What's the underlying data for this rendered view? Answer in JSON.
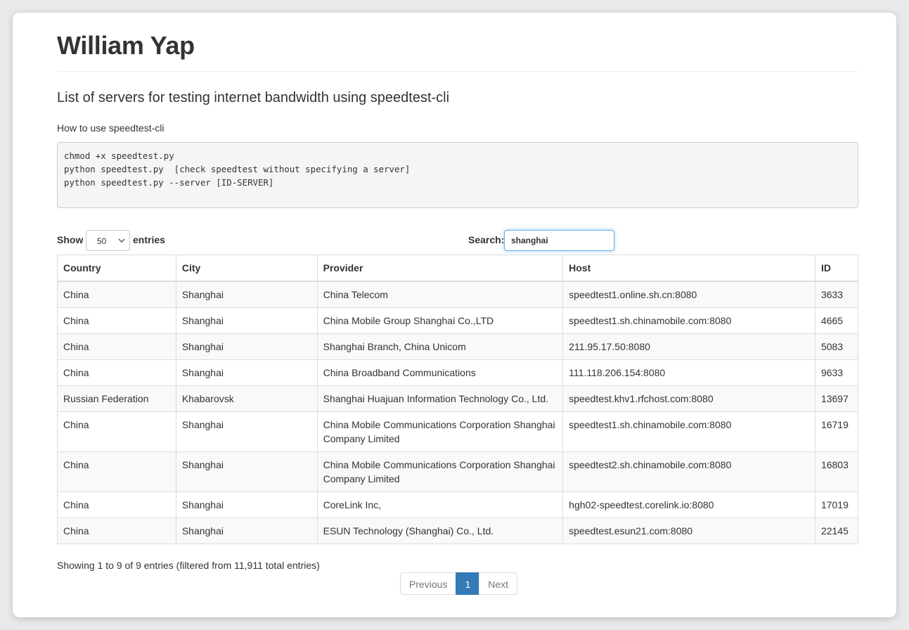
{
  "page": {
    "title": "William Yap",
    "lead": "List of servers for testing internet bandwidth using speedtest-cli",
    "howto_label": "How to use speedtest-cli",
    "code_lines": [
      "chmod +x speedtest.py",
      "python speedtest.py  [check speedtest without specifying a server]",
      "python speedtest.py --server [ID-SERVER]"
    ]
  },
  "controls": {
    "show_label": "Show",
    "length_value": "50",
    "entries_label": "entries",
    "search_label": "Search:",
    "search_value": "shanghai"
  },
  "table": {
    "headers": [
      "Country",
      "City",
      "Provider",
      "Host",
      "ID"
    ],
    "rows": [
      [
        "China",
        "Shanghai",
        "China Telecom",
        "speedtest1.online.sh.cn:8080",
        "3633"
      ],
      [
        "China",
        "Shanghai",
        "China Mobile Group Shanghai Co.,LTD",
        "speedtest1.sh.chinamobile.com:8080",
        "4665"
      ],
      [
        "China",
        "Shanghai",
        "Shanghai Branch, China Unicom",
        "211.95.17.50:8080",
        "5083"
      ],
      [
        "China",
        "Shanghai",
        "China Broadband Communications",
        "111.118.206.154:8080",
        "9633"
      ],
      [
        "Russian Federation",
        "Khabarovsk",
        "Shanghai Huajuan Information Technology Co., Ltd.",
        "speedtest.khv1.rfchost.com:8080",
        "13697"
      ],
      [
        "China",
        "Shanghai",
        "China Mobile Communications Corporation Shanghai Company Limited",
        "speedtest1.sh.chinamobile.com:8080",
        "16719"
      ],
      [
        "China",
        "Shanghai",
        "China Mobile Communications Corporation Shanghai Company Limited",
        "speedtest2.sh.chinamobile.com:8080",
        "16803"
      ],
      [
        "China",
        "Shanghai",
        "CoreLink Inc,",
        "hgh02-speedtest.corelink.io:8080",
        "17019"
      ],
      [
        "China",
        "Shanghai",
        "ESUN Technology (Shanghai) Co., Ltd.",
        "speedtest.esun21.com:8080",
        "22145"
      ]
    ]
  },
  "footer": {
    "info": "Showing 1 to 9 of 9 entries (filtered from 11,911 total entries)",
    "previous_label": "Previous",
    "current_page": "1",
    "next_label": "Next"
  },
  "colors": {
    "accent": "#337ab7",
    "focus": "#66afe9",
    "border": "#dddddd",
    "stripe": "#f9f9f9"
  }
}
